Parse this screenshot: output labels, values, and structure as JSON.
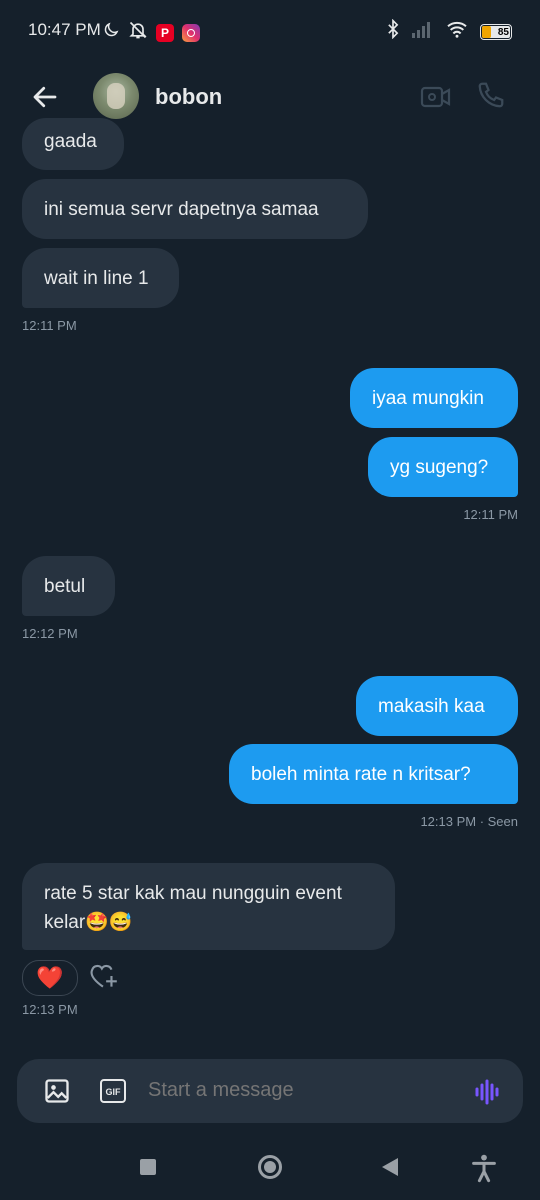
{
  "status_bar": {
    "time": "10:47 PM",
    "battery": "85",
    "icons": [
      "moon-icon",
      "bell-off-icon",
      "pinterest-icon",
      "instagram-icon",
      "bluetooth-icon",
      "signal-icon",
      "wifi-icon",
      "battery-icon"
    ]
  },
  "header": {
    "contact_name": "bobon",
    "icons": [
      "back-arrow-icon",
      "video-call-icon",
      "phone-call-icon"
    ]
  },
  "messages": [
    {
      "side": "in",
      "text": "gaada"
    },
    {
      "side": "in",
      "text": "ini semua servr dapetnya samaa"
    },
    {
      "side": "in",
      "text": "wait in line 1"
    },
    {
      "side": "out",
      "text": "iyaa mungkin"
    },
    {
      "side": "out",
      "text": "yg sugeng?"
    },
    {
      "side": "in",
      "text": "betul"
    },
    {
      "side": "out",
      "text": "makasih kaa"
    },
    {
      "side": "out",
      "text": "boleh minta rate n kritsar?"
    },
    {
      "side": "in",
      "text_line1": "rate 5 star kak mau nungguin event",
      "text_line2": "kelar🤩😅"
    }
  ],
  "timestamps": {
    "t1": "12:11 PM",
    "t2": "12:11 PM",
    "t3": "12:12 PM",
    "t4": "12:13 PM · Seen",
    "t5": "12:13 PM"
  },
  "reaction": {
    "emoji": "❤️"
  },
  "composer": {
    "placeholder": "Start a message",
    "gif_label": "GIF"
  },
  "colors": {
    "background": "#15202b",
    "incoming_bubble": "#273340",
    "outgoing_bubble": "#1d9bf0",
    "accent_voice": "#7856ff"
  }
}
